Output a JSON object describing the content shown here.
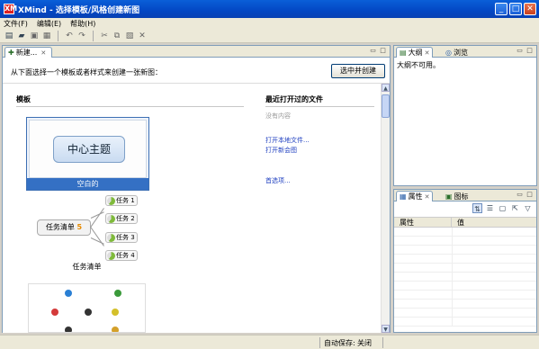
{
  "window": {
    "app_icon": "XM",
    "title": "XMind - 选择模板/风格创建新图",
    "controls": [
      "minimize-icon",
      "maximize-icon",
      "close-icon"
    ]
  },
  "menubar": {
    "items": [
      "文件(F)",
      "编辑(E)",
      "帮助(H)"
    ]
  },
  "toolbar": {
    "icons": [
      "new-icon",
      "open-icon",
      "save-icon",
      "print-icon",
      "undo-icon",
      "redo-icon",
      "cut-icon",
      "copy-icon",
      "paste-icon",
      "delete-icon"
    ]
  },
  "editor": {
    "tab_label": "新建...",
    "intro_text": "从下面选择一个模板或者样式来创建一张新图：",
    "create_button": "选中并创建",
    "templates": {
      "heading": "模板",
      "blank": {
        "central_topic": "中心主题",
        "caption": "空白的"
      },
      "tasks": {
        "root": "任务清单",
        "root_badge": "5",
        "nodes": [
          "任务 1",
          "任务 2",
          "任务 3",
          "任务 4"
        ],
        "caption": "任务清单"
      }
    },
    "recent": {
      "heading": "最近打开过的文件",
      "empty": "没有内容",
      "links": [
        "打开本地文件...",
        "打开新会图",
        "首选项..."
      ]
    }
  },
  "outline_panel": {
    "tabs": [
      {
        "label": "大纲",
        "icon": "outline-icon"
      },
      {
        "label": "浏览",
        "icon": "overview-icon"
      }
    ],
    "message": "大纲不可用。"
  },
  "properties_panel": {
    "tabs": [
      {
        "label": "属性",
        "icon": "properties-icon"
      },
      {
        "label": "图标",
        "icon": "markers-icon"
      }
    ],
    "columns": [
      "属性",
      "值"
    ]
  },
  "statusbar": {
    "autosave_label": "自动保存:",
    "autosave_value": "关闭"
  },
  "colors": {
    "titlebar": "#0347c4",
    "selection": "#3470c4",
    "link": "#2040c0"
  }
}
